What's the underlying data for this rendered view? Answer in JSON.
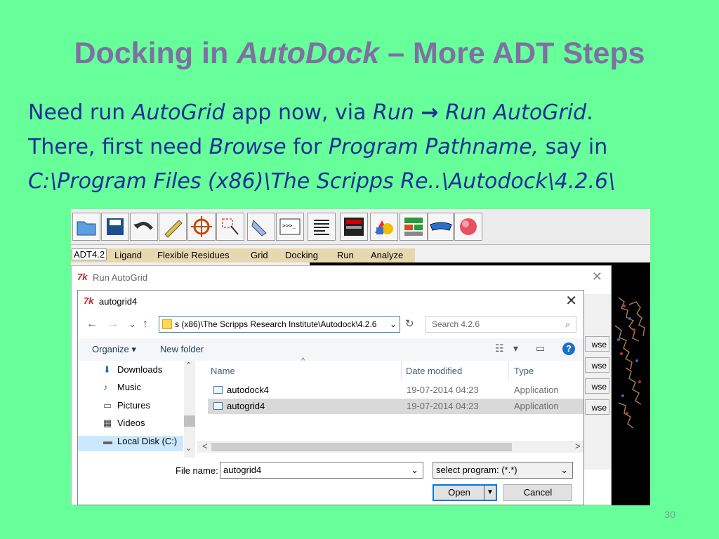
{
  "slide": {
    "title_part1": "Docking in ",
    "title_italic": "AutoDock",
    "title_part2": " – More ADT Steps",
    "line1_a": "Need run ",
    "line1_b": "AutoGrid",
    "line1_c": " app now, via ",
    "line1_d": "Run",
    "line1_arrow": "→",
    "line1_e": "Run AutoGrid",
    "line1_f": ".",
    "line2_a": "There, first need ",
    "line2_b": "Browse",
    "line2_c": " for ",
    "line2_d": "Program Pathname,",
    "line2_e": " say in",
    "line3": "C:\\Program Files (x86)\\The Scripps Re..\\Autodock\\4.2.6\\",
    "number": "30"
  },
  "adt": {
    "menu": [
      "ADT4.2",
      "Ligand",
      "Flexible Residues",
      "Grid",
      "Docking",
      "Run",
      "Analyze"
    ],
    "run_window_title": "Run AutoGrid",
    "browse_label": "wse",
    "window_close": "✕"
  },
  "dialog": {
    "title": "autogrid4",
    "tk_icon": "7k",
    "close": "✕",
    "back": "←",
    "forward": "→",
    "recent": "⌄",
    "up": "↑",
    "address": "s (x86)\\The Scripps Research Institute\\Autodock\\4.2.6",
    "address_dropdown": "⌄",
    "refresh": "↻",
    "search_placeholder": "Search 4.2.6",
    "search_icon": "⌕",
    "organize": "Organize ▾",
    "new_folder": "New folder",
    "view_icon": "☷",
    "view_dropdown": "▾",
    "preview_icon": "▭",
    "help": "?",
    "nav_up_arrow": "⌃",
    "nav_down_arrow": "⌄",
    "nav_items": [
      "Downloads",
      "Music",
      "Pictures",
      "Videos",
      "Local Disk (C:)"
    ],
    "nav_icons": [
      "⬇",
      "♪",
      "▭",
      "▦",
      "▬"
    ],
    "sort_indicator": "^",
    "columns": [
      "Name",
      "Date modified",
      "Type"
    ],
    "files": [
      {
        "name": "autodock4",
        "date": "19-07-2014 04:23",
        "type": "Application"
      },
      {
        "name": "autogrid4",
        "date": "19-07-2014 04:23",
        "type": "Application"
      }
    ],
    "scroll_left": "<",
    "scroll_right": ">",
    "file_name_label": "File name:",
    "file_name_value": "autogrid4",
    "file_name_dropdown": "⌄",
    "filter_value": "select program: (*.*)",
    "filter_dropdown": "⌄",
    "open_label": "Open",
    "open_split": "▼",
    "cancel_label": "Cancel"
  },
  "colors": {
    "background": "#66ff99",
    "title": "#7f6fa3",
    "body_text": "#1f2f99",
    "selection": "#cce8ff"
  }
}
